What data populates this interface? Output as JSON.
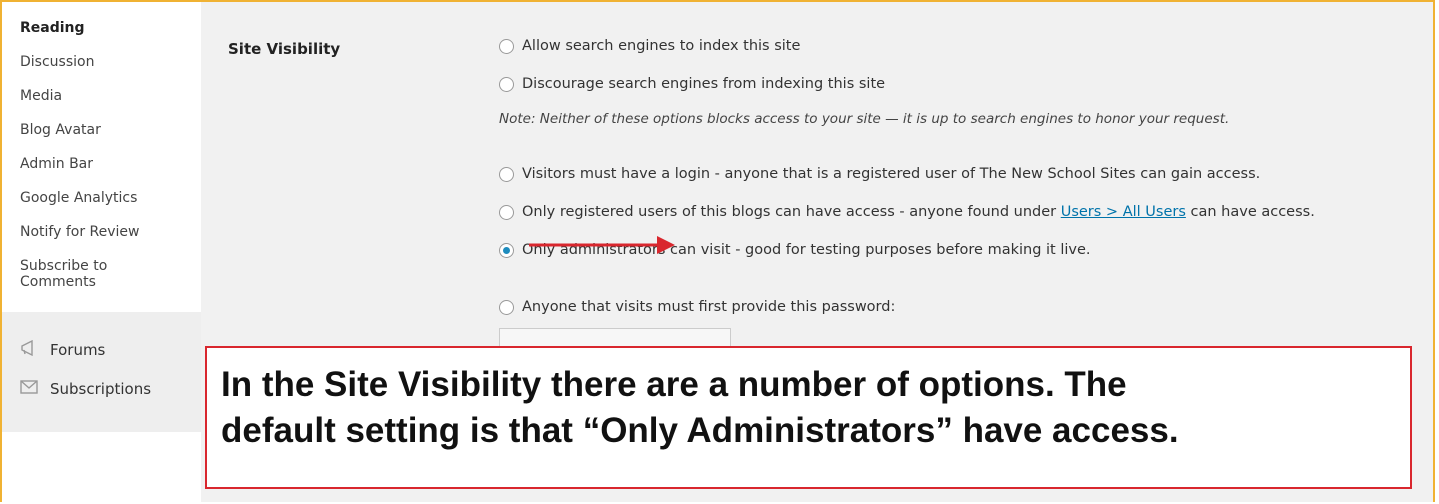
{
  "sidebar": {
    "submenu": [
      {
        "label": "Reading",
        "current": true
      },
      {
        "label": "Discussion"
      },
      {
        "label": "Media"
      },
      {
        "label": "Blog Avatar"
      },
      {
        "label": "Admin Bar"
      },
      {
        "label": "Google Analytics"
      },
      {
        "label": "Notify for Review"
      },
      {
        "label": "Subscribe to Comments"
      }
    ],
    "menu": [
      {
        "label": "Forums",
        "icon": "megaphone-icon"
      },
      {
        "label": "Subscriptions",
        "icon": "envelope-icon"
      }
    ]
  },
  "settings": {
    "section_label": "Site Visibility",
    "options": [
      {
        "label": "Allow search engines to index this site",
        "checked": false
      },
      {
        "label": "Discourage search engines from indexing this site",
        "checked": false
      },
      {
        "label": "Visitors must have a login - anyone that is a registered user of The New School Sites can gain access.",
        "checked": false
      },
      {
        "label_before": "Only registered users of this blogs can have access - anyone found under ",
        "link": "Users > All Users",
        "label_after": " can have access.",
        "checked": false
      },
      {
        "label": "Only administrators can visit - good for testing purposes before making it live.",
        "checked": true
      },
      {
        "label": "Anyone that visits must first provide this password:",
        "checked": false
      }
    ],
    "note": "Note: Neither of these options blocks access to your site — it is up to search engines to honor your request.",
    "password_value": ""
  },
  "callout": {
    "line1": "In the Site Visibility there are a number of options. The",
    "line2": "default setting is that “Only Administrators” have access."
  },
  "colors": {
    "frame": "#f0b233",
    "arrow": "#d9272e",
    "callout_border": "#d9272e",
    "radio_checked": "#1e8cbe",
    "link": "#0073aa"
  }
}
